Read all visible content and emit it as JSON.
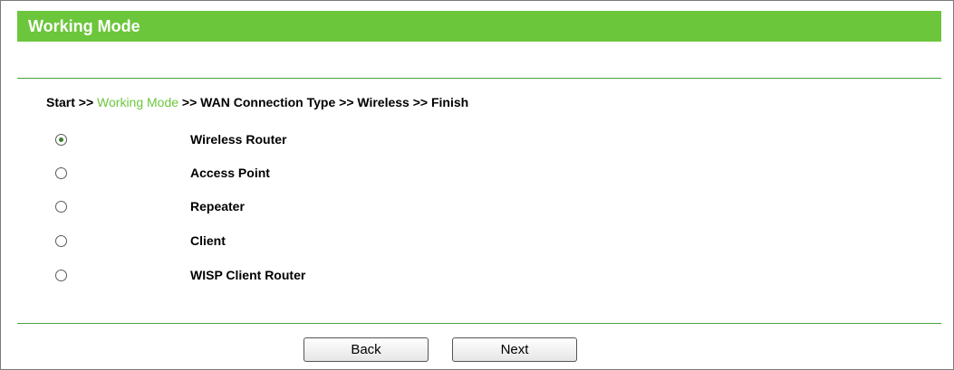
{
  "header": {
    "title": "Working Mode"
  },
  "breadcrumb": {
    "start": "Start >> ",
    "current": "Working Mode",
    "rest": " >> WAN Connection Type >> Wireless >> Finish"
  },
  "modes": [
    {
      "label": "Wireless Router",
      "selected": true
    },
    {
      "label": "Access Point",
      "selected": false
    },
    {
      "label": "Repeater",
      "selected": false
    },
    {
      "label": "Client",
      "selected": false
    },
    {
      "label": "WISP Client Router",
      "selected": false
    }
  ],
  "buttons": {
    "back_label": "Back",
    "next_label": "Next"
  },
  "colors": {
    "accent": "#6cc63b",
    "divider": "#4aa245"
  }
}
